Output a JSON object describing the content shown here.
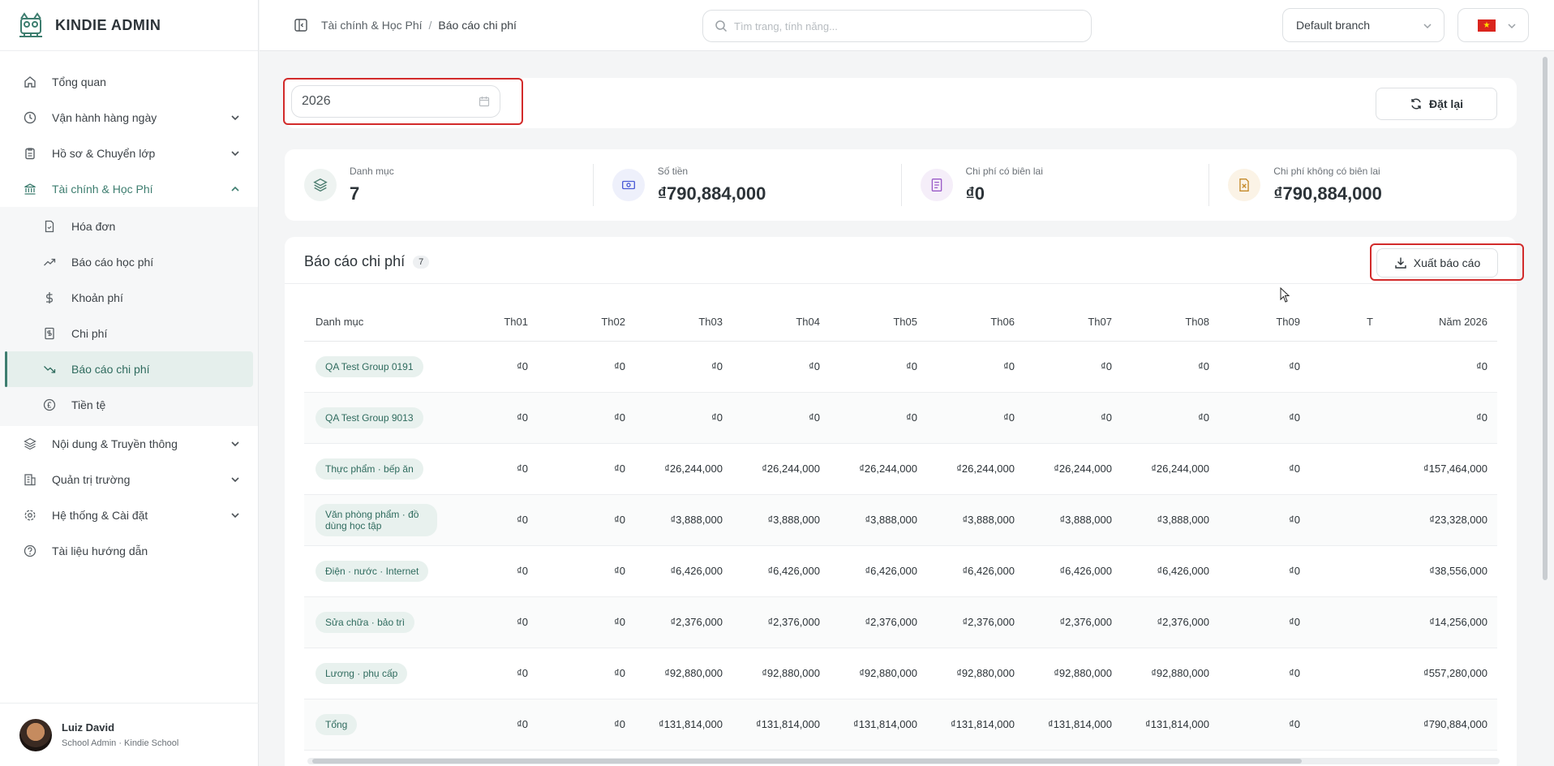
{
  "app": {
    "name": "KINDIE ADMIN"
  },
  "sidebar": {
    "items": [
      {
        "label": "Tổng quan",
        "icon": "home-icon"
      },
      {
        "label": "Vận hành hàng ngày",
        "icon": "clock-icon"
      },
      {
        "label": "Hồ sơ & Chuyển lớp",
        "icon": "clipboard-icon"
      },
      {
        "label": "Tài chính & Học Phí",
        "icon": "bank-icon"
      },
      {
        "label": "Nội dung & Truyền thông",
        "icon": "layers-icon"
      },
      {
        "label": "Quản trị trường",
        "icon": "building-icon"
      },
      {
        "label": "Hệ thống & Cài đặt",
        "icon": "gear-icon"
      },
      {
        "label": "Tài liệu hướng dẫn",
        "icon": "help-circle-icon"
      }
    ],
    "finance_sub": [
      {
        "label": "Hóa đơn",
        "icon": "invoice-icon"
      },
      {
        "label": "Báo cáo học phí",
        "icon": "trending-up-icon"
      },
      {
        "label": "Khoản phí",
        "icon": "dollar-icon"
      },
      {
        "label": "Chi phí",
        "icon": "receipt-icon"
      },
      {
        "label": "Báo cáo chi phí",
        "icon": "trending-down-icon"
      },
      {
        "label": "Tiền tệ",
        "icon": "currency-icon"
      }
    ]
  },
  "user": {
    "name": "Luiz David",
    "role": "School Admin · Kindie School"
  },
  "header": {
    "breadcrumb": [
      "Tài chính & Học Phí",
      "Báo cáo chi phí"
    ],
    "search_placeholder": "Tìm trang, tính năng...",
    "branch": "Default branch"
  },
  "filter": {
    "year": "2026",
    "reset_label": "Đặt lại"
  },
  "stats": [
    {
      "title": "Danh mục",
      "value": "7",
      "icon": "layers-icon",
      "color": "#4b7d6f"
    },
    {
      "title": "Số tiền",
      "value": "₫790,884,000",
      "icon": "money-icon",
      "color": "#4b5bd6"
    },
    {
      "title": "Chi phí có biên lai",
      "value": "₫0",
      "icon": "document-icon",
      "color": "#9a5bc8"
    },
    {
      "title": "Chi phí không có biên lai",
      "value": "₫790,884,000",
      "icon": "file-x-icon",
      "color": "#c58a2a"
    }
  ],
  "report": {
    "title": "Báo cáo chi phí",
    "count": "7",
    "export_label": "Xuất báo cáo",
    "columns": [
      "Danh mục",
      "Th01",
      "Th02",
      "Th03",
      "Th04",
      "Th05",
      "Th06",
      "Th07",
      "Th08",
      "Th09",
      "T",
      "Năm 2026"
    ],
    "rows": [
      [
        "QA Test Group 0191",
        "₫0",
        "₫0",
        "₫0",
        "₫0",
        "₫0",
        "₫0",
        "₫0",
        "₫0",
        "₫0",
        "",
        "₫0"
      ],
      [
        "QA Test Group 9013",
        "₫0",
        "₫0",
        "₫0",
        "₫0",
        "₫0",
        "₫0",
        "₫0",
        "₫0",
        "₫0",
        "",
        "₫0"
      ],
      [
        "Thực phẩm · bếp ăn",
        "₫0",
        "₫0",
        "₫26,244,000",
        "₫26,244,000",
        "₫26,244,000",
        "₫26,244,000",
        "₫26,244,000",
        "₫26,244,000",
        "₫0",
        "",
        "₫157,464,000"
      ],
      [
        "Văn phòng phẩm · đồ dùng học tập",
        "₫0",
        "₫0",
        "₫3,888,000",
        "₫3,888,000",
        "₫3,888,000",
        "₫3,888,000",
        "₫3,888,000",
        "₫3,888,000",
        "₫0",
        "",
        "₫23,328,000"
      ],
      [
        "Điện · nước · Internet",
        "₫0",
        "₫0",
        "₫6,426,000",
        "₫6,426,000",
        "₫6,426,000",
        "₫6,426,000",
        "₫6,426,000",
        "₫6,426,000",
        "₫0",
        "",
        "₫38,556,000"
      ],
      [
        "Sửa chữa · bảo trì",
        "₫0",
        "₫0",
        "₫2,376,000",
        "₫2,376,000",
        "₫2,376,000",
        "₫2,376,000",
        "₫2,376,000",
        "₫2,376,000",
        "₫0",
        "",
        "₫14,256,000"
      ],
      [
        "Lương · phụ cấp",
        "₫0",
        "₫0",
        "₫92,880,000",
        "₫92,880,000",
        "₫92,880,000",
        "₫92,880,000",
        "₫92,880,000",
        "₫92,880,000",
        "₫0",
        "",
        "₫557,280,000"
      ],
      [
        "Tổng",
        "₫0",
        "₫0",
        "₫131,814,000",
        "₫131,814,000",
        "₫131,814,000",
        "₫131,814,000",
        "₫131,814,000",
        "₫131,814,000",
        "₫0",
        "",
        "₫790,884,000"
      ]
    ]
  },
  "colors": {
    "accent": "#3d7d6f",
    "highlight": "#d22b2b"
  }
}
